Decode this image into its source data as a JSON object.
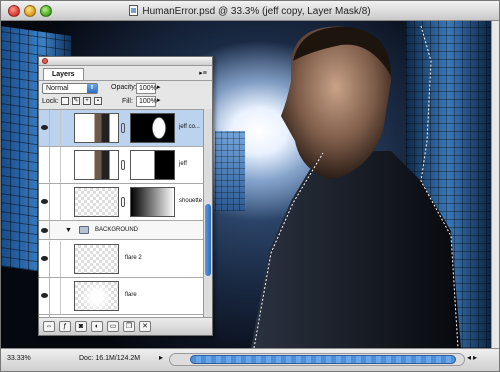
{
  "window": {
    "title": "HumanError.psd @ 33.3% (jeff copy, Layer Mask/8)"
  },
  "status": {
    "zoom": "33.33%",
    "doc_info": "Doc: 16.1M/124.2M"
  },
  "layers_palette": {
    "tab_label": "Layers",
    "blend_mode": "Normal",
    "opacity_label": "Opacity:",
    "opacity_value": "100%",
    "lock_label": "Lock:",
    "fill_label": "Fill:",
    "fill_value": "100%",
    "layers": [
      {
        "name": "jeff co...",
        "selected": true
      },
      {
        "name": "jeff",
        "selected": false
      },
      {
        "name": "shouette",
        "selected": false
      },
      {
        "name": "BACKGROUND",
        "group": true
      },
      {
        "name": "flare 2",
        "selected": false
      },
      {
        "name": "flare",
        "selected": false
      }
    ]
  },
  "colors": {
    "selection_blue": "#bcd3f0",
    "scroll_blue": "#4f8fd8",
    "window_bg": "#d8d8d8"
  },
  "icons": [
    "close-icon",
    "minimize-icon",
    "zoom-icon",
    "document-icon",
    "eye-icon",
    "link-icon",
    "folder-icon",
    "disclosure-triangle-icon",
    "lock-transparency-icon",
    "lock-paint-icon",
    "lock-move-icon",
    "lock-all-icon"
  ]
}
